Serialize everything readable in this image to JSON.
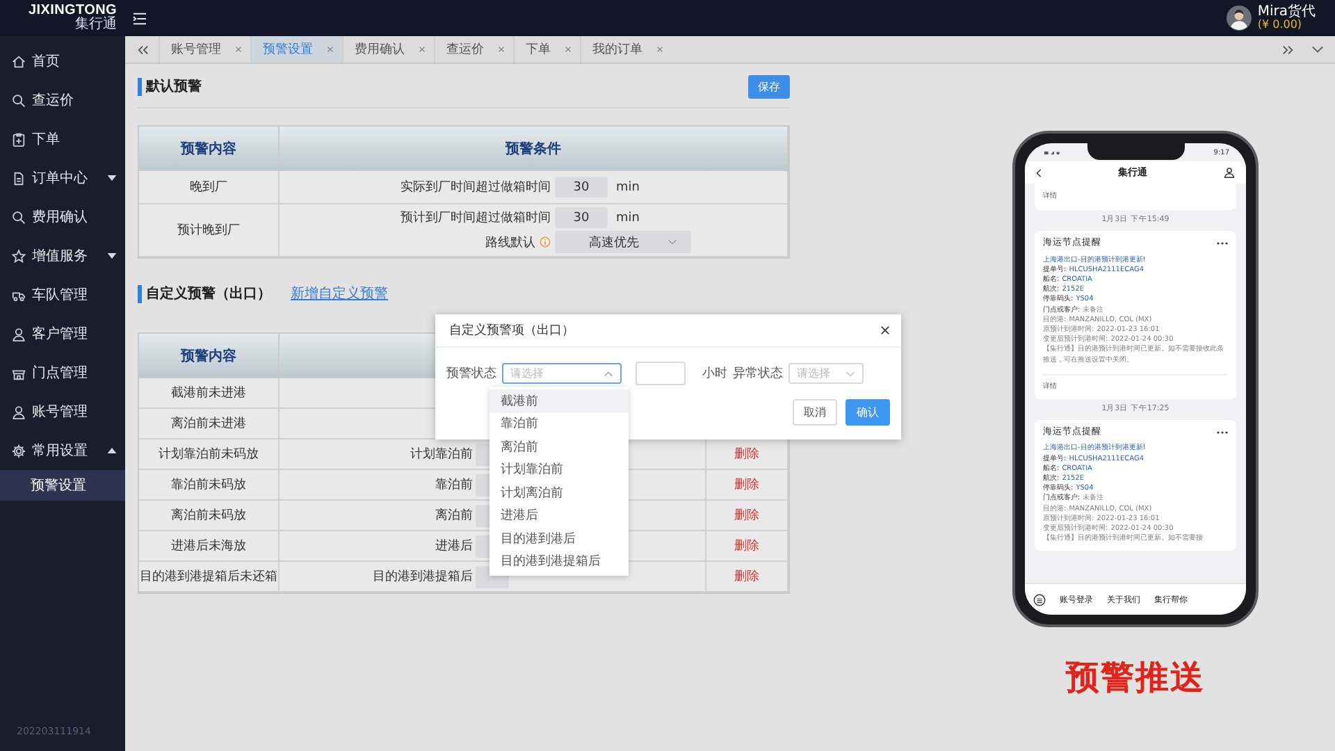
{
  "header": {
    "logo": "JIXINGTONG",
    "logo_sub": "集行通",
    "user_name": "Mira货代",
    "balance": "(¥ 0.00)"
  },
  "sidebar": {
    "items": [
      {
        "label": "首页",
        "selected": false
      },
      {
        "label": "查运价",
        "selected": false
      },
      {
        "label": "下单",
        "selected": false
      },
      {
        "label": "订单中心",
        "selected": false,
        "expanded": false
      },
      {
        "label": "费用确认",
        "selected": false
      },
      {
        "label": "增值服务",
        "selected": false,
        "expanded": false
      },
      {
        "label": "车队管理",
        "selected": false
      },
      {
        "label": "客户管理",
        "selected": false
      },
      {
        "label": "门点管理",
        "selected": false
      },
      {
        "label": "账号管理",
        "selected": false
      },
      {
        "label": "常用设置",
        "selected": false,
        "expanded": true,
        "children": [
          {
            "label": "预警设置",
            "selected": true
          }
        ]
      }
    ],
    "version": "202203111914"
  },
  "tabs": [
    {
      "label": "账号管理",
      "selected": false
    },
    {
      "label": "预警设置",
      "selected": true
    },
    {
      "label": "费用确认",
      "selected": false
    },
    {
      "label": "查运价",
      "selected": false
    },
    {
      "label": "下单",
      "selected": false
    },
    {
      "label": "我的订单",
      "selected": false
    }
  ],
  "default_alerts": {
    "title": "默认预警",
    "save_button": "保存",
    "columns": [
      "预警内容",
      "预警条件"
    ],
    "rows": [
      {
        "content": "晚到厂",
        "conditions": [
          {
            "kind": "input",
            "label": "实际到厂时间超过做箱时间",
            "value": "30",
            "unit": "min"
          }
        ]
      },
      {
        "content": "预计晚到厂",
        "conditions": [
          {
            "kind": "input",
            "label": "预计到厂时间超过做箱时间",
            "value": "30",
            "unit": "min"
          },
          {
            "kind": "select",
            "label": "路线默认",
            "value": "高速优先"
          }
        ]
      }
    ]
  },
  "custom_alerts": {
    "title": "自定义预警（出口）",
    "add_link": "新增自定义预警",
    "columns": [
      "预警内容"
    ],
    "rows": [
      {
        "content": "截港前未进港"
      },
      {
        "content": "离泊前未进港"
      },
      {
        "content": "计划靠泊前未码放",
        "condition": "计划靠泊前",
        "action": "删除"
      },
      {
        "content": "靠泊前未码放",
        "condition": "靠泊前",
        "action": "删除"
      },
      {
        "content": "离泊前未码放",
        "condition": "离泊前",
        "action": "删除"
      },
      {
        "content": "进港后未海放",
        "condition": "进港后",
        "action": "删除"
      },
      {
        "content": "目的港到港提箱后未还箱",
        "condition": "目的港到港提箱后",
        "action": "删除"
      }
    ]
  },
  "dialog": {
    "title": "自定义预警项（出口）",
    "status_label": "预警状态",
    "status_placeholder": "请选择",
    "hours_unit": "小时",
    "abnormal_label": "异常状态",
    "abnormal_placeholder": "请选择",
    "cancel_button": "取消",
    "confirm_button": "确认",
    "options": [
      {
        "label": "截港前",
        "selected": true
      },
      {
        "label": "靠泊前",
        "selected": false
      },
      {
        "label": "离泊前",
        "selected": false
      },
      {
        "label": "计划靠泊前",
        "selected": false
      },
      {
        "label": "计划离泊前",
        "selected": false
      },
      {
        "label": "进港后",
        "selected": false
      },
      {
        "label": "目的港到港后",
        "selected": false
      },
      {
        "label": "目的港到港提箱后",
        "selected": false
      }
    ]
  },
  "phone": {
    "status_time": "9:17",
    "title": "集行通",
    "top_link": "详情",
    "messages": [
      {
        "time": "1月3日 下午15:49",
        "title": "海运节点提醒",
        "headline": "上海港出口-目的港预计到港更新!",
        "fields": [
          {
            "label": "提单号:",
            "value": "HLCUSHA2111ECAG4",
            "kind": "accent"
          },
          {
            "label": "船名:",
            "value": "CROATIA",
            "kind": "accent"
          },
          {
            "label": "航次:",
            "value": "2152E",
            "kind": "accent"
          },
          {
            "label": "停靠码头:",
            "value": "YS04",
            "kind": "accent"
          },
          {
            "label": "门点或客户:",
            "value": "未备注",
            "kind": "muted"
          },
          {
            "label": "目的港:",
            "value": "MANZANILLO, COL (MX)",
            "kind": "grey"
          },
          {
            "label": "原预计到港时间:",
            "value": "2022-01-23 16:01",
            "kind": "grey"
          },
          {
            "label": "变更后预计到港时间:",
            "value": "2022-01-24 00:30",
            "kind": "grey"
          }
        ],
        "note": "【集行通】目的港预计到港时间已更新。如不需要接收此条推送，可在推送设置中关闭。",
        "link": "详情"
      },
      {
        "time": "1月3日 下午17:25",
        "title": "海运节点提醒",
        "headline": "上海港出口-目的港预计到港更新!",
        "fields": [
          {
            "label": "提单号:",
            "value": "HLCUSHA2111ECAG4",
            "kind": "accent"
          },
          {
            "label": "船名:",
            "value": "CROATIA",
            "kind": "accent"
          },
          {
            "label": "航次:",
            "value": "2152E",
            "kind": "accent"
          },
          {
            "label": "停靠码头:",
            "value": "YS04",
            "kind": "accent"
          },
          {
            "label": "门点或客户:",
            "value": "未备注",
            "kind": "muted"
          },
          {
            "label": "目的港:",
            "value": "MANZANILLO, COL (MX)",
            "kind": "grey"
          },
          {
            "label": "原预计到港时间:",
            "value": "2022-01-23 16:01",
            "kind": "grey"
          },
          {
            "label": "变更后预计到港时间:",
            "value": "2022-01-24 00:30",
            "kind": "grey"
          }
        ],
        "note": "【集行通】目的港预计到港时间已更新。如不需要接"
      }
    ],
    "footer": [
      "账号登录",
      "关于我们",
      "集行帮你"
    ]
  },
  "caption": "预警推送"
}
